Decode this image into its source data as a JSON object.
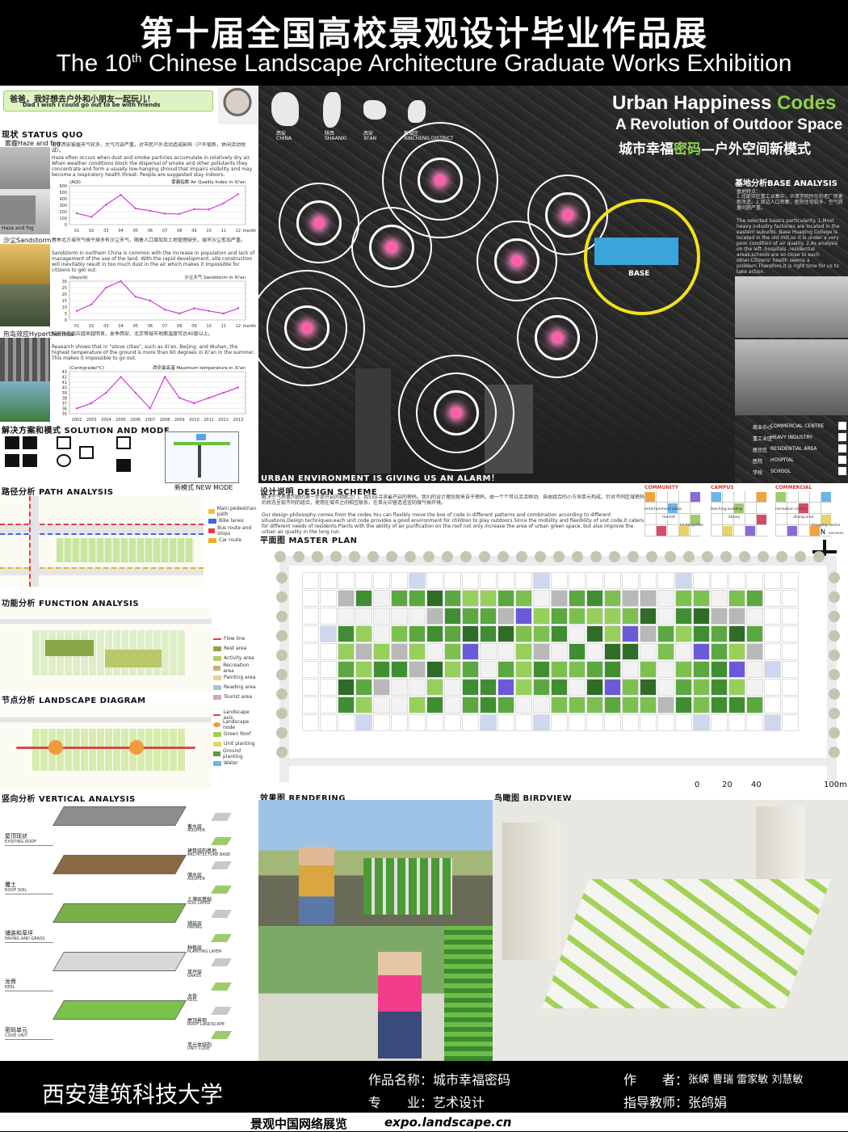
{
  "header": {
    "title_cn": "第十届全国高校景观设计毕业作品展",
    "title_en_pre": "The 10",
    "title_en_sup": "th",
    "title_en_post": " Chinese Landscape Architecture Graduate Works Exhibition"
  },
  "speech": {
    "cn": "爸爸，我好想去户外和小朋友一起玩儿！",
    "en": "Dad I wish I could go out to be with friends"
  },
  "status_quo": {
    "title": "现状 STATUS QUO",
    "haze_label": "雾霾Haze and fog",
    "haze_text_cn": "近年西安雾霾天气较多，大气污染严重，对市民户外活动造成影响（户外锻炼，休闲活动锐减）。",
    "haze_text_en": "Haze often occurs when dust and smoke particles accumulate in relatively dry air. When weather conditions block the dispersal of smoke and other pollutants they concentrate and form a usually low-hanging shroud that impairs visibility and may become a respiratory health threat. People are suggested stay indoors.",
    "haze_thumb_caption": "Haze and fog",
    "sand_label": "沙尘Sandstorm",
    "sand_text_cn": "春季北方城市气候干燥多有沙尘天气，随着人口增加及土地管理缺失，城市沙尘愈加严重。",
    "sand_text_en": "Sandstorm in northern China is common with the increase in population and lack of management of the use of the land. With the rapid development, site construction will inevitably result in too much dust in the air which makes it impossible for citizens to get out.",
    "heat_label": "热岛效应Hyperthermia",
    "heat_text_cn": "城市热岛效应越来越明显，夏季西安、北京等城市地面温度可达40度以上。",
    "heat_text_en": "Research shows that in \"stove cities\", such as Xi'an, Beijing, and Wuhan, the highest temperature of the ground is more than 60 degrees in Xi'an in the summer. This makes it impossible to go out."
  },
  "chart_data": [
    {
      "type": "line",
      "title": "雾霾指数 Air Quality Index in Xi'an",
      "ylabel": "(AQI)",
      "xlabel": "month",
      "categories": [
        "01",
        "02",
        "03",
        "04",
        "05",
        "06",
        "07",
        "08",
        "09",
        "10",
        "11",
        "12"
      ],
      "values": [
        175,
        120,
        310,
        460,
        250,
        215,
        170,
        165,
        240,
        235,
        330,
        470
      ],
      "ylim": [
        0,
        600
      ],
      "yticks": [
        "0",
        "100",
        "200",
        "300",
        "400",
        "500",
        "600"
      ],
      "color": "#d23bd6"
    },
    {
      "type": "line",
      "title": "沙尘天气 Sandstorm in Xi'an",
      "ylabel": "(days/d)",
      "xlabel": "month",
      "categories": [
        "01",
        "02",
        "03",
        "04",
        "05",
        "06",
        "07",
        "08",
        "09",
        "10",
        "11",
        "12"
      ],
      "values": [
        7,
        12,
        25,
        30,
        18,
        15,
        8,
        5,
        9,
        7,
        5,
        9
      ],
      "ylim": [
        0,
        30
      ],
      "yticks": [
        "0",
        "5",
        "10",
        "15",
        "20",
        "25",
        "30"
      ],
      "color": "#d23bd6"
    },
    {
      "type": "line",
      "title": "西安最高温 Maximum temperature in Xi'an",
      "ylabel": "(Centigrade/°C)",
      "xlabel": "",
      "categories": [
        "2002",
        "2003",
        "2004",
        "2005",
        "2006",
        "2007",
        "2008",
        "2009",
        "2010",
        "2011",
        "2012",
        "2013"
      ],
      "values": [
        36,
        37,
        39,
        42,
        39,
        36,
        42,
        38,
        37,
        38,
        39,
        40
      ],
      "ylim": [
        35,
        43
      ],
      "yticks": [
        "35",
        "36",
        "37",
        "38",
        "39",
        "40",
        "41",
        "42",
        "43"
      ],
      "color": "#d23bd6"
    }
  ],
  "solution": {
    "title": "解决方案和模式 SOLUTION AND MODE",
    "new_mode": "新模式 NEW MODE"
  },
  "path": {
    "title": "路径分析 PATH ANALYSIS",
    "legend": [
      "Main pedestrian path",
      "Bike lanes",
      "Bus route and stops",
      "Car route"
    ]
  },
  "function": {
    "title": "功能分析 FUNCTION ANALYSIS",
    "legend": [
      "Flow line",
      "Rest area",
      "Activity area",
      "Recreation area",
      "Painting area",
      "Reading area",
      "Tourist area"
    ]
  },
  "landscape": {
    "title": "节点分析 LANDSCAPE DIAGRAM",
    "legend": [
      "Landscape axis",
      "Landscape node",
      "Green Roof",
      "Unit planting",
      "Ground planting",
      "Water"
    ]
  },
  "vertical": {
    "title": "竖向分析 VERTICAL ANALYSIS",
    "left_labels": [
      {
        "cn": "屋顶现状",
        "en": "EXISTING ROOF"
      },
      {
        "cn": "覆土",
        "en": "ROOF SOIL"
      },
      {
        "cn": "铺装和草坪",
        "en": "PAVING AND GRASS"
      },
      {
        "cn": "龙骨",
        "en": "KEEL"
      },
      {
        "cn": "密码单元",
        "en": "CODE UNIT"
      }
    ],
    "right_labels": [
      {
        "cn": "蓄水层",
        "en": "AQUIFER"
      },
      {
        "cn": "建筑结构基地",
        "en": "ARCHITECTURE BASE"
      },
      {
        "cn": "储水层",
        "en": "AQUIFER"
      },
      {
        "cn": "土壤层基础",
        "en": "SOIL LAYER"
      },
      {
        "cn": "铺装层",
        "en": "PAVING"
      },
      {
        "cn": "种植层",
        "en": "PLANTING LAYER"
      },
      {
        "cn": "草坪层",
        "en": "GRASS"
      },
      {
        "cn": "龙骨",
        "en": "KEEL"
      },
      {
        "cn": "屋顶景观",
        "en": "ROOF LANDSCAPE"
      },
      {
        "cn": "单元体结构",
        "en": "UNIT CODE"
      }
    ]
  },
  "map": {
    "region_labels": [
      {
        "cn": "西安",
        "en": "CHINA"
      },
      {
        "cn": "陕西",
        "en": "SHAANXI"
      },
      {
        "cn": "西安",
        "en": "XI'AN"
      },
      {
        "cn": "新城区",
        "en": "XINCHENG DISTRICT"
      }
    ],
    "project_title_1": "Urban Happiness ",
    "project_title_codes": "Codes",
    "project_title_2": "A Revolution of  Outdoor Space",
    "project_title_cn_1": "城市幸福",
    "project_title_cn_hl": "密码",
    "project_title_cn_2": "—户外空间新模式",
    "base_label": "BASE",
    "alarm": "URBAN ENVIRONMENT IS GIVING US AN ALARM！",
    "base_analysis_title": "基地分析BASE ANALYSIS",
    "base_analysis_sub": "基地特点：",
    "base_analysis_cn": "1.北部郊区重工业集中，华清学院所在的老厂房更新改造。2.周边人口密集，医院住宅较多，空气质量问题严重。",
    "base_analysis_en": "The selected base's particularity. 1.Most heavy industry factories are located in the eastern suburbs. Base Huaqing College is located in the old mill,so it is under a very poor condition of air quality. 2.As analysis on the left ,hospitals ,residential areas,schools are so close to each other.Citizens' health seems a problem.Therefore,it is right time for us to take action.",
    "map_legend": [
      {
        "cn": "商业中心",
        "en": "COMMERCIAL CENTRE"
      },
      {
        "cn": "重工业区",
        "en": "HEAVY INDUSTRY"
      },
      {
        "cn": "居住区",
        "en": "RESIDENTIAL AREA"
      },
      {
        "cn": "医院",
        "en": "HOSPITAL"
      },
      {
        "cn": "学校",
        "en": "SCHOOL"
      }
    ]
  },
  "design": {
    "title": "设计说明 DESIGN SCHEME",
    "text_cn": "解决空气质量问题的第一步是开启的钥匙之门，我们应寻求最开启的密码，我们的设计理念就来自于密码，由一个个可以灵活移动、自由组合的小方块单元构成，针对不同区域密码的状态呈现不同的组合，使用在城市之间相互联系，在单元中营造适宜的微气候环境。",
    "text_en": "Our design philosophy comes from the codes.You can flexibly move the box of code in different patterns and combination according to different situations.Design techniques:each unit code provides a good environment for children to play outdoors.Since the mobility and flexibility of unit code,it caters for different needs of residents.Plants with the ability of air purification on the roof not only increase the area of urban green space, but also improve the urban air quality in the long run.",
    "grids": [
      {
        "title": "COMMUNITY",
        "cells": [
          "entertainment plaza",
          "market",
          "kindergarten"
        ]
      },
      {
        "title": "CAMPUS",
        "cells": [
          "teaching building",
          "library"
        ]
      },
      {
        "title": "COMMERCIAL",
        "cells": [
          "recreation centre",
          "dining area",
          "shopping centre",
          "services"
        ]
      }
    ],
    "master_plan_title": "平面图 MASTER PLAN",
    "north": "N",
    "scale": [
      "0",
      "20",
      "40",
      "100m"
    ]
  },
  "rendering": {
    "title": "效果图 RENDERING"
  },
  "birdview": {
    "title": "鸟瞰图 BIRDVIEW"
  },
  "footer": {
    "school": "西安建筑科技大学",
    "work_label": "作品名称：",
    "work_name": "城市幸福密码",
    "major_label": "专　　业：",
    "major": "艺术设计",
    "author_label": "作　　者：",
    "authors": "张嵘  曹瑞  雷家敏  刘慧敏",
    "advisor_label": "指导教师：",
    "advisor": "张鸽娟",
    "site_cn": "景观中国网络展览",
    "site_url": "expo.landscape.cn"
  },
  "colors": {
    "accent_green": "#8fd14f",
    "pink": "#ff5fa8",
    "base_ring": "#f2e21a",
    "chart_line": "#d23bd6"
  }
}
